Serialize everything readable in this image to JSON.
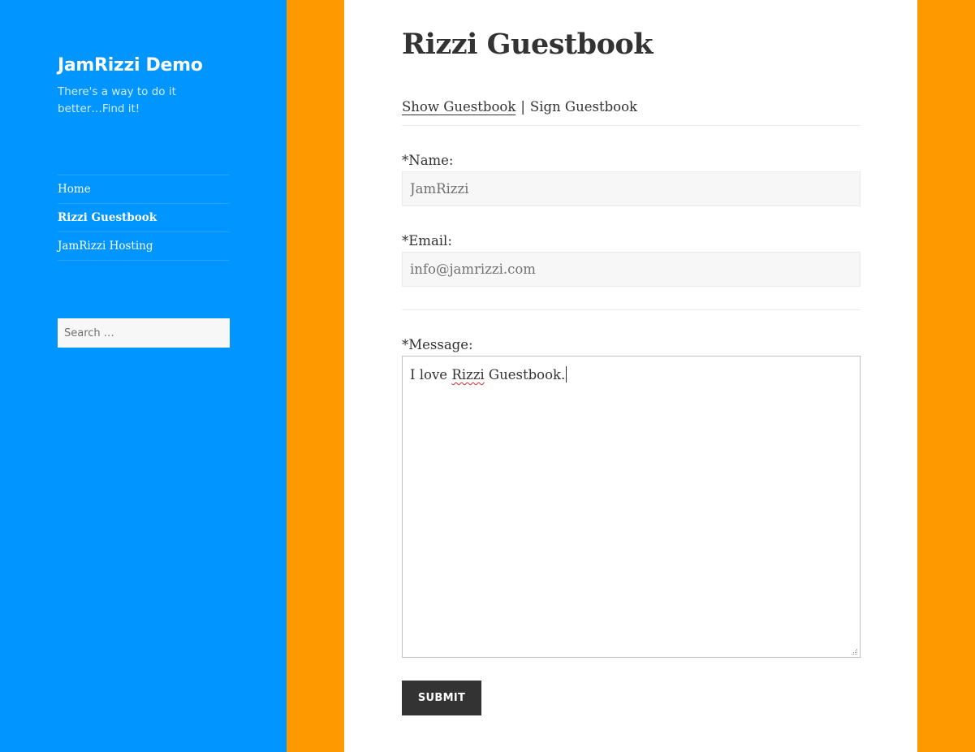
{
  "site": {
    "title": "JamRizzi Demo",
    "description": "There's a way to do it better…Find it!"
  },
  "nav": {
    "items": [
      {
        "label": "Home",
        "current": false
      },
      {
        "label": "Rizzi Guestbook",
        "current": true
      },
      {
        "label": "JamRizzi Hosting",
        "current": false
      }
    ]
  },
  "search": {
    "placeholder": "Search …",
    "value": ""
  },
  "page": {
    "title": "Rizzi Guestbook"
  },
  "guestbook_links": {
    "show_label": "Show Guestbook",
    "separator": "|",
    "sign_label": "Sign Guestbook"
  },
  "form": {
    "name_label": "*Name:",
    "name_value": "JamRizzi",
    "email_label": "*Email:",
    "email_value": "info@jamrizzi.com",
    "message_label": "*Message:",
    "message_before": "I love ",
    "message_misspelled": "Rizzi",
    "message_after": " Guestbook.",
    "submit_label": "SUBMIT"
  },
  "colors": {
    "sidebar_bg": "#0095ff",
    "page_bg": "#ff9900",
    "content_bg": "#ffffff",
    "text": "#333333",
    "button_bg": "#333333"
  }
}
